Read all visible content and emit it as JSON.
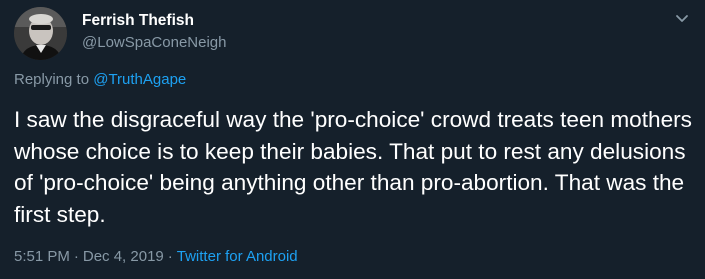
{
  "tweet": {
    "author": {
      "display_name": "Ferrish Thefish",
      "handle": "@LowSpaConeNeigh",
      "avatar_icon": "user-avatar"
    },
    "menu_icon": "chevron-down-icon",
    "replying_prefix": "Replying to ",
    "replying_to": "@TruthAgape",
    "text": "I saw the disgraceful way the 'pro-choice' crowd treats teen mothers whose choice is to keep their babies. That put to rest any delusions of 'pro-choice' being anything other than pro-abortion. That was the first step.",
    "time": "5:51 PM",
    "separator": "·",
    "date": "Dec 4, 2019",
    "source": "Twitter for Android"
  },
  "colors": {
    "background": "#15202b",
    "text_primary": "#ffffff",
    "text_secondary": "#8899a6",
    "link": "#1da1f2"
  }
}
